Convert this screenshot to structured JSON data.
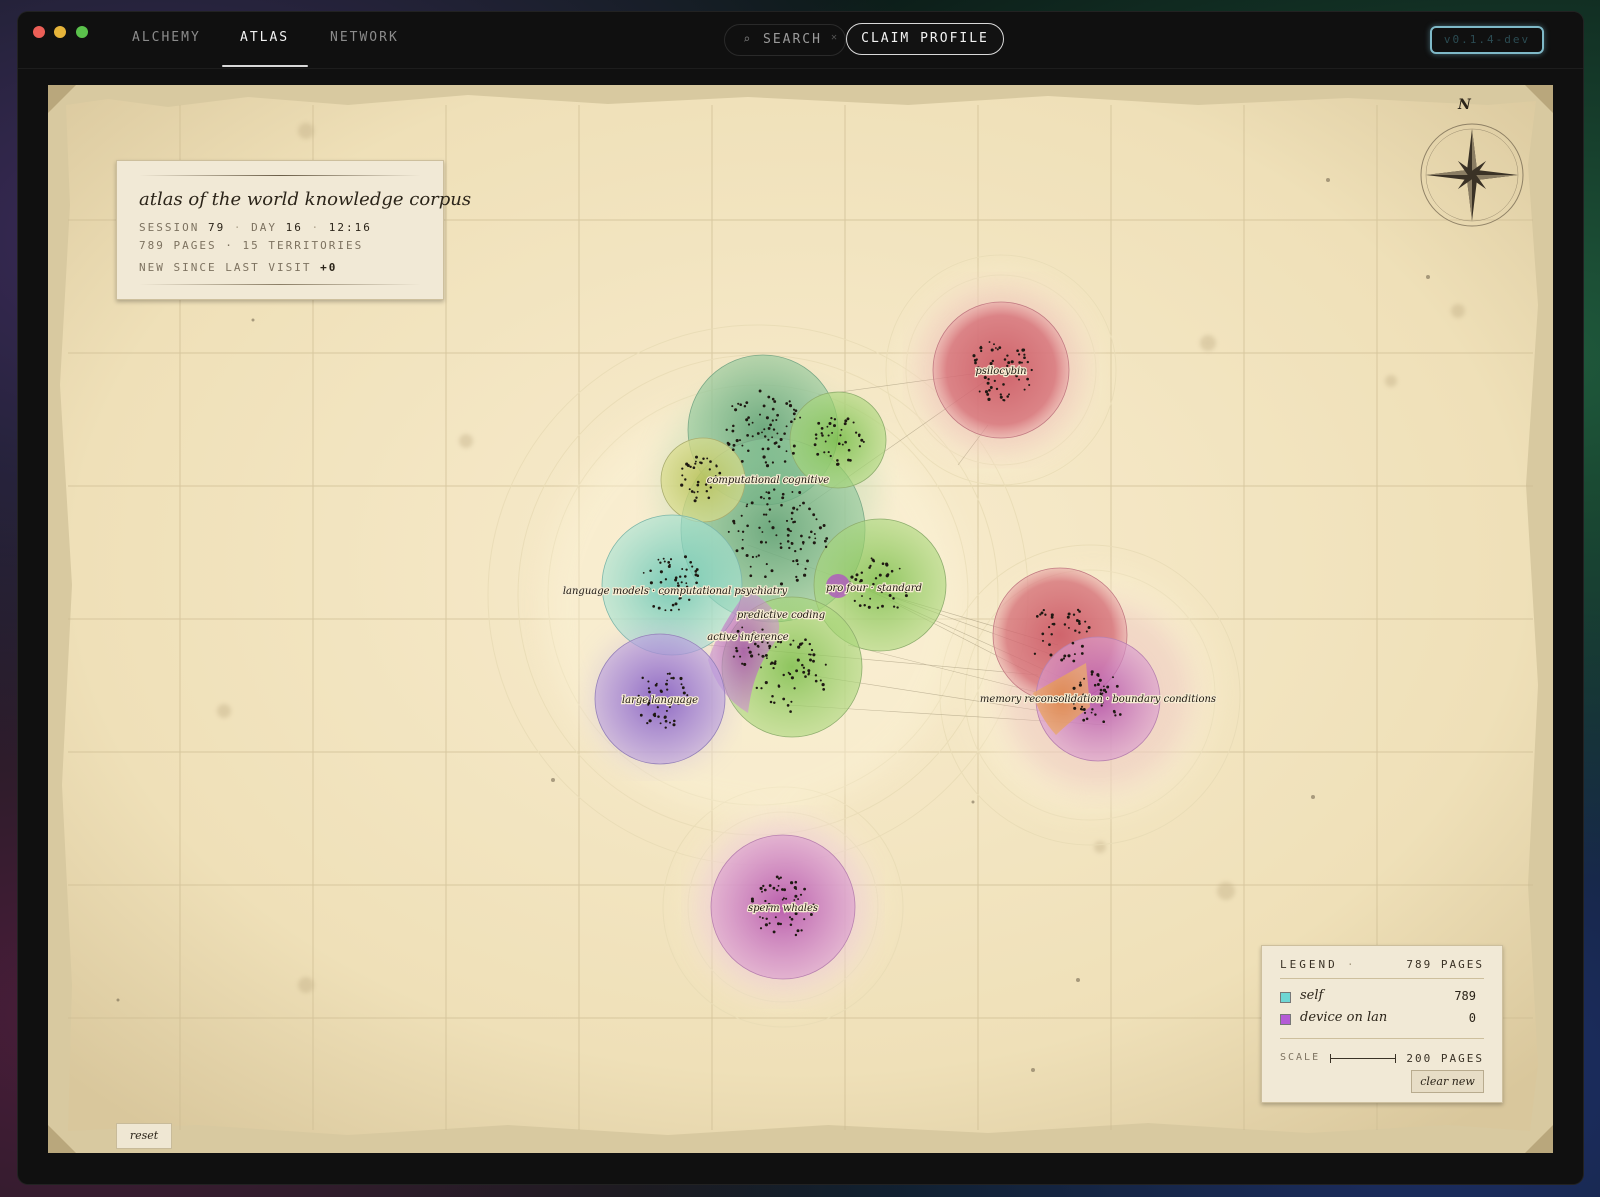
{
  "nav": {
    "tabs": [
      "ALCHEMY",
      "ATLAS",
      "NETWORK"
    ],
    "active_tab": "ATLAS",
    "search_label": "SEARCH",
    "claim_label": "CLAIM PROFILE",
    "version": "v0.1.4-dev"
  },
  "titlecard": {
    "title": "atlas of the world knowledge corpus",
    "session_label": "SESSION",
    "session": "79",
    "day_label": "DAY",
    "day": "16",
    "time": "12:16",
    "pages_line": "789 PAGES · 15 TERRITORIES",
    "new_since_label": "NEW SINCE LAST VISIT",
    "new_since_value": "+0"
  },
  "compass": {
    "north": "N"
  },
  "territories": [
    {
      "label": "psilocybin",
      "color": "#d94c5f"
    },
    {
      "label": "computational cognitive",
      "color": "#6bb27a"
    },
    {
      "label": "language models · computational psychiatry",
      "color": "#7ed3c0"
    },
    {
      "label": "pro four · standard",
      "color": "#7dc25a"
    },
    {
      "label": "predictive coding",
      "color": "#8fcf55"
    },
    {
      "label": "active inference",
      "color": "#b04ec0"
    },
    {
      "label": "large language",
      "color": "#8a5fc4"
    },
    {
      "label": "memory reconsolidation · boundary conditions",
      "color": "#d9587a"
    },
    {
      "label": "sperm whales",
      "color": "#c55bb6"
    }
  ],
  "legend": {
    "title": "LEGEND",
    "total": "789 PAGES",
    "rows": [
      {
        "name": "self",
        "value": "789",
        "color": "#6ed6d4"
      },
      {
        "name": "device on lan",
        "value": "0",
        "color": "#b45bd6"
      }
    ],
    "scale_label": "SCALE",
    "scale_value": "200 PAGES",
    "clear_label": "clear new"
  },
  "reset_label": "reset"
}
